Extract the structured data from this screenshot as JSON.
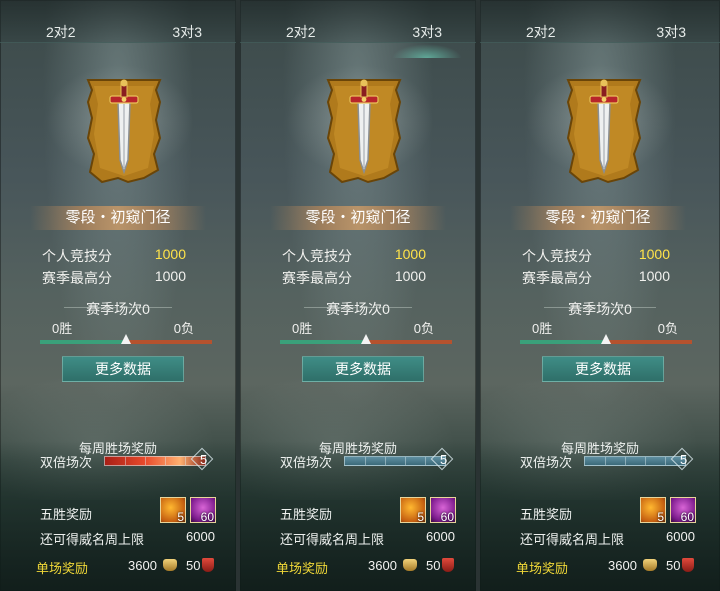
{
  "panels": [
    {
      "tabs": {
        "left": "2对2",
        "right": "3对3",
        "active": "none"
      },
      "rank": "零段・初窥门径",
      "personal_score_label": "个人竞技分",
      "personal_score": "1000",
      "season_high_label": "赛季最高分",
      "season_high": "1000",
      "season_matches": "赛季场次0",
      "wins": "0胜",
      "losses": "0负",
      "more_data": "更多数据",
      "weekly_title": "每周胜场奖励",
      "double_label": "双倍场次",
      "double_count": "5",
      "double_state": "fire",
      "five_win_label": "五胜奖励",
      "item1_count": "5",
      "item2_count": "60",
      "cap_label": "还可得威名周上限",
      "cap_value": "6000",
      "single_label": "单场奖励",
      "single_v1": "3600",
      "single_v2": "50"
    },
    {
      "tabs": {
        "left": "2对2",
        "right": "3对3",
        "active": "right"
      },
      "rank": "零段・初窥门径",
      "personal_score_label": "个人竞技分",
      "personal_score": "1000",
      "season_high_label": "赛季最高分",
      "season_high": "1000",
      "season_matches": "赛季场次0",
      "wins": "0胜",
      "losses": "0负",
      "more_data": "更多数据",
      "weekly_title": "每周胜场奖励",
      "double_label": "双倍场次",
      "double_count": "5",
      "double_state": "normal",
      "five_win_label": "五胜奖励",
      "item1_count": "5",
      "item2_count": "60",
      "cap_label": "还可得威名周上限",
      "cap_value": "6000",
      "single_label": "单场奖励",
      "single_v1": "3600",
      "single_v2": "50"
    },
    {
      "tabs": {
        "left": "2对2",
        "right": "3对3",
        "active": "none"
      },
      "rank": "零段・初窥门径",
      "personal_score_label": "个人竞技分",
      "personal_score": "1000",
      "season_high_label": "赛季最高分",
      "season_high": "1000",
      "season_matches": "赛季场次0",
      "wins": "0胜",
      "losses": "0负",
      "more_data": "更多数据",
      "weekly_title": "每周胜场奖励",
      "double_label": "双倍场次",
      "double_count": "5",
      "double_state": "normal",
      "five_win_label": "五胜奖励",
      "item1_count": "5",
      "item2_count": "60",
      "cap_label": "还可得威名周上限",
      "cap_value": "6000",
      "single_label": "单场奖励",
      "single_v1": "3600",
      "single_v2": "50"
    }
  ],
  "progress": {
    "win_fraction": 0.5
  },
  "colors": {
    "gold": "#ffe34a",
    "accent": "#3aa07a",
    "loss": "#b5522e",
    "button": "#3f8d86"
  }
}
